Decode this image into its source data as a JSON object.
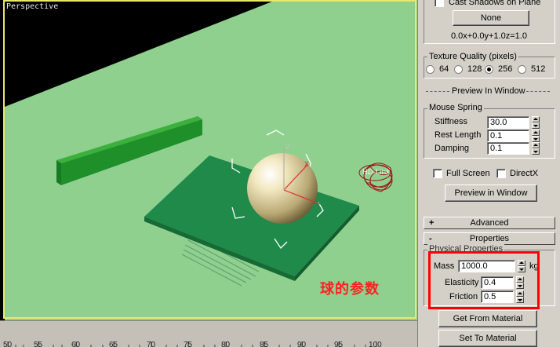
{
  "viewport": {
    "label": "Perspective",
    "object_label": "HD-Link",
    "annotation": "球的参数",
    "colors": {
      "ground": "#8fd08f",
      "plate": "#1f8a4a",
      "wall": "#1f8f2a",
      "sphere": "#ece0b0",
      "background": "#000000",
      "selection_border": "#e8e86a"
    }
  },
  "ruler": {
    "ticks": [
      "50",
      "55",
      "60",
      "65",
      "70",
      "75",
      "80",
      "85",
      "90",
      "95",
      "100"
    ]
  },
  "panel": {
    "shadows": {
      "label": "Cast Shadows on Plane",
      "button": "None",
      "plane_eq": "0.0x+0.0y+1.0z=1.0"
    },
    "texture": {
      "title": "Texture Quality (pixels)",
      "options": [
        "64",
        "128",
        "256",
        "512"
      ],
      "selected": "256"
    },
    "preview_bar": "Preview In Window",
    "mouse_spring": {
      "title": "Mouse Spring",
      "stiffness_label": "Stiffness",
      "stiffness": "30.0",
      "rest_length_label": "Rest Length",
      "rest_length": "0.1",
      "damping_label": "Damping",
      "damping": "0.1"
    },
    "full_screen_label": "Full Screen",
    "directx_label": "DirectX",
    "preview_button": "Preview in Window",
    "advanced": {
      "sign": "+",
      "label": "Advanced"
    },
    "properties": {
      "sign": "-",
      "label": "Properties"
    },
    "physical": {
      "title": "Physical Properties",
      "mass_label": "Mass",
      "mass": "1000.0",
      "mass_unit": "kg",
      "elasticity_label": "Elasticity",
      "elasticity": "0.4",
      "friction_label": "Friction",
      "friction": "0.5"
    },
    "get_from_material": "Get From Material",
    "set_to_material": "Set To Material"
  }
}
